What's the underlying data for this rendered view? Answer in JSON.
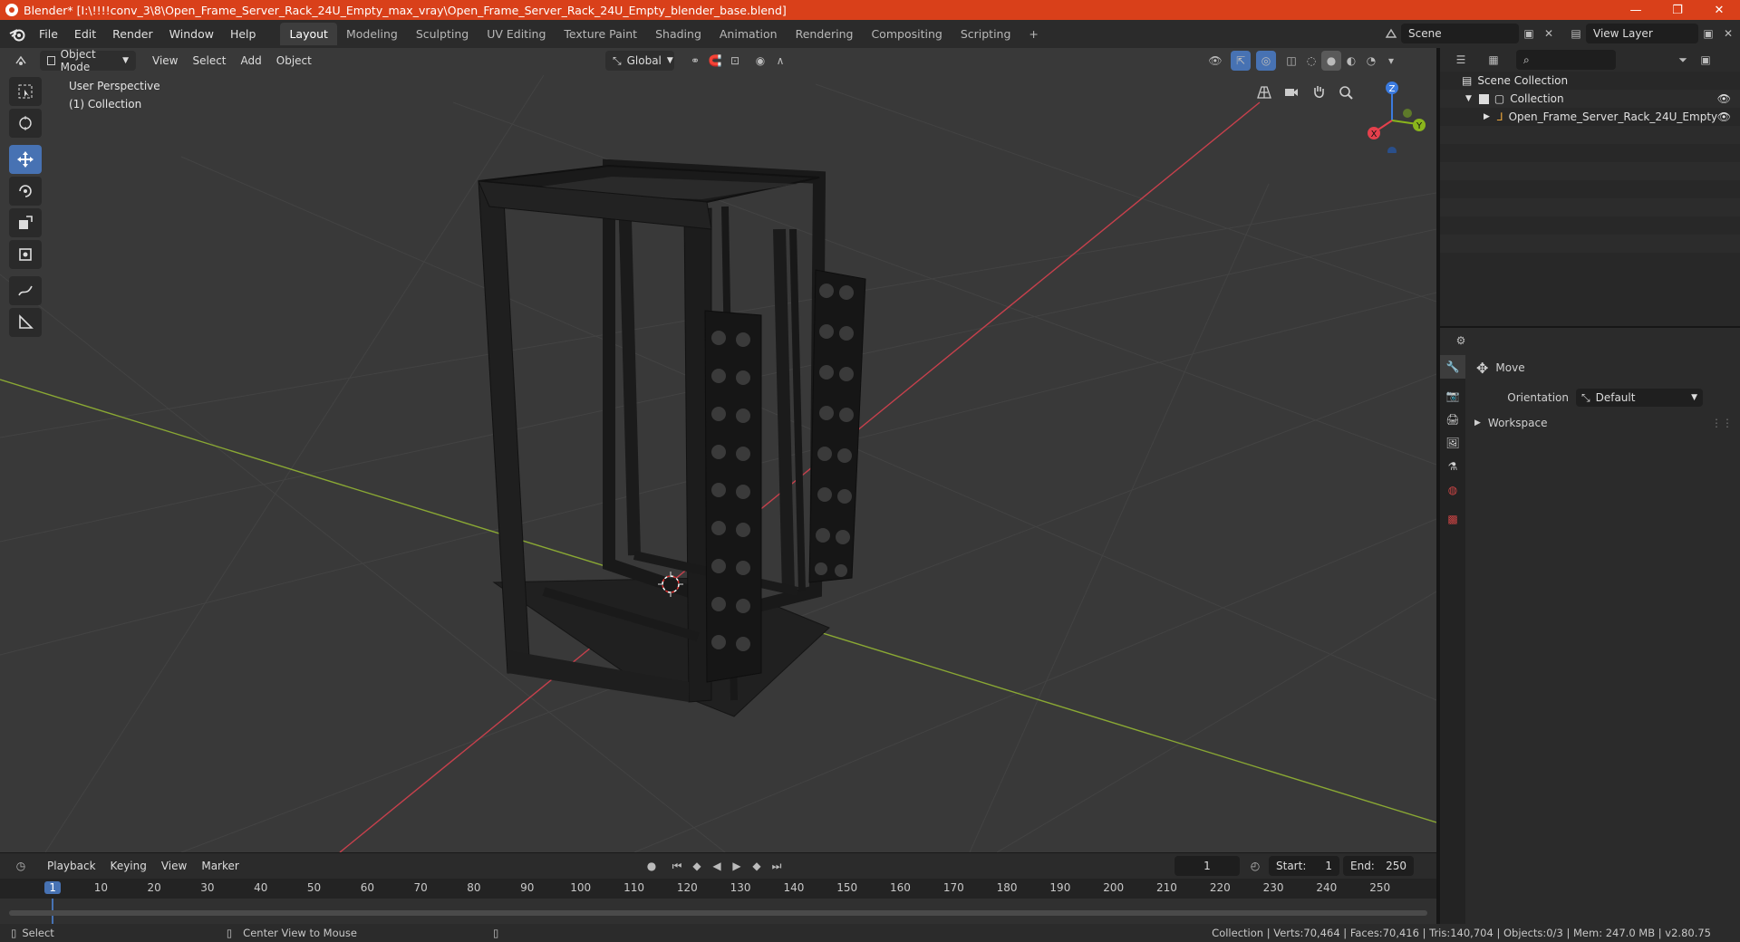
{
  "window": {
    "title": "Blender* [I:\\!!!!conv_3\\8\\Open_Frame_Server_Rack_24U_Empty_max_vray\\Open_Frame_Server_Rack_24U_Empty_blender_base.blend]",
    "minimize": "—",
    "restore": "❐",
    "close": "✕"
  },
  "menu": [
    "File",
    "Edit",
    "Render",
    "Window",
    "Help"
  ],
  "workspaces": [
    "Layout",
    "Modeling",
    "Sculpting",
    "UV Editing",
    "Texture Paint",
    "Shading",
    "Animation",
    "Rendering",
    "Compositing",
    "Scripting"
  ],
  "active_workspace": "Layout",
  "add_workspace": "+",
  "scene": {
    "label": "Scene",
    "view_layer": "View Layer"
  },
  "viewport": {
    "mode": "Object Mode",
    "menus": [
      "View",
      "Select",
      "Add",
      "Object"
    ],
    "orientation": "Global",
    "info_line1": "User Perspective",
    "info_line2": "(1) Collection",
    "gizmo_labels": {
      "x": "X",
      "y": "Y",
      "z": "Z"
    },
    "colors": {
      "background": "#393939",
      "x_axis": "#c7404c",
      "y_axis": "#8aa834",
      "accent": "#4772b3"
    }
  },
  "timeline": {
    "menus": [
      "Playback",
      "Keying",
      "View",
      "Marker"
    ],
    "current_frame": "1",
    "start_label": "Start:",
    "start": "1",
    "end_label": "End:",
    "end": "250",
    "frame_ticks": [
      "1",
      "10",
      "20",
      "30",
      "40",
      "50",
      "60",
      "70",
      "80",
      "90",
      "100",
      "110",
      "120",
      "130",
      "140",
      "150",
      "160",
      "170",
      "180",
      "190",
      "200",
      "210",
      "220",
      "230",
      "240",
      "250"
    ]
  },
  "outliner": {
    "root": "Scene Collection",
    "collection": "Collection",
    "object": "Open_Frame_Server_Rack_24U_Empty"
  },
  "properties": {
    "tool_name": "Move",
    "orientation_label": "Orientation",
    "orientation_value": "Default",
    "section": "Workspace"
  },
  "status": {
    "select": "Select",
    "center_view": "Center View to Mouse",
    "stats": "Collection | Verts:70,464 | Faces:70,416 | Tris:140,704 | Objects:0/3 | Mem: 247.0 MB | v2.80.75"
  }
}
